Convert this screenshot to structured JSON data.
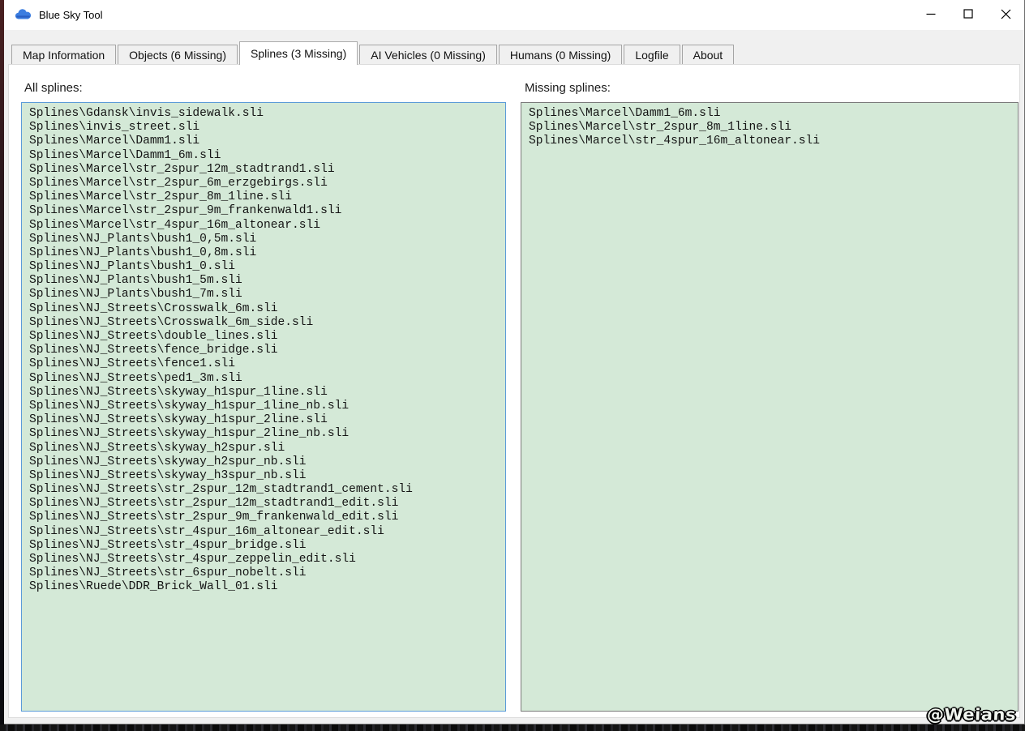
{
  "window": {
    "title": "Blue Sky Tool",
    "icon": "cloud-icon"
  },
  "tabs": [
    {
      "id": "map-information",
      "label": "Map Information",
      "active": false
    },
    {
      "id": "objects",
      "label": "Objects (6 Missing)",
      "active": false
    },
    {
      "id": "splines",
      "label": "Splines (3 Missing)",
      "active": true
    },
    {
      "id": "ai-vehicles",
      "label": "AI Vehicles (0 Missing)",
      "active": false
    },
    {
      "id": "humans",
      "label": "Humans (0 Missing)",
      "active": false
    },
    {
      "id": "logfile",
      "label": "Logfile",
      "active": false
    },
    {
      "id": "about",
      "label": "About",
      "active": false
    }
  ],
  "panels": {
    "all_splines": {
      "label": "All splines:",
      "items": [
        "Splines\\Gdansk\\invis_sidewalk.sli",
        "Splines\\invis_street.sli",
        "Splines\\Marcel\\Damm1.sli",
        "Splines\\Marcel\\Damm1_6m.sli",
        "Splines\\Marcel\\str_2spur_12m_stadtrand1.sli",
        "Splines\\Marcel\\str_2spur_6m_erzgebirgs.sli",
        "Splines\\Marcel\\str_2spur_8m_1line.sli",
        "Splines\\Marcel\\str_2spur_9m_frankenwald1.sli",
        "Splines\\Marcel\\str_4spur_16m_altonear.sli",
        "Splines\\NJ_Plants\\bush1_0,5m.sli",
        "Splines\\NJ_Plants\\bush1_0,8m.sli",
        "Splines\\NJ_Plants\\bush1_0.sli",
        "Splines\\NJ_Plants\\bush1_5m.sli",
        "Splines\\NJ_Plants\\bush1_7m.sli",
        "Splines\\NJ_Streets\\Crosswalk_6m.sli",
        "Splines\\NJ_Streets\\Crosswalk_6m_side.sli",
        "Splines\\NJ_Streets\\double_lines.sli",
        "Splines\\NJ_Streets\\fence_bridge.sli",
        "Splines\\NJ_Streets\\fence1.sli",
        "Splines\\NJ_Streets\\ped1_3m.sli",
        "Splines\\NJ_Streets\\skyway_h1spur_1line.sli",
        "Splines\\NJ_Streets\\skyway_h1spur_1line_nb.sli",
        "Splines\\NJ_Streets\\skyway_h1spur_2line.sli",
        "Splines\\NJ_Streets\\skyway_h1spur_2line_nb.sli",
        "Splines\\NJ_Streets\\skyway_h2spur.sli",
        "Splines\\NJ_Streets\\skyway_h2spur_nb.sli",
        "Splines\\NJ_Streets\\skyway_h3spur_nb.sli",
        "Splines\\NJ_Streets\\str_2spur_12m_stadtrand1_cement.sli",
        "Splines\\NJ_Streets\\str_2spur_12m_stadtrand1_edit.sli",
        "Splines\\NJ_Streets\\str_2spur_9m_frankenwald_edit.sli",
        "Splines\\NJ_Streets\\str_4spur_16m_altonear_edit.sli",
        "Splines\\NJ_Streets\\str_4spur_bridge.sli",
        "Splines\\NJ_Streets\\str_4spur_zeppelin_edit.sli",
        "Splines\\NJ_Streets\\str_6spur_nobelt.sli",
        "Splines\\Ruede\\DDR_Brick_Wall_01.sli"
      ]
    },
    "missing_splines": {
      "label": "Missing splines:",
      "items": [
        "Splines\\Marcel\\Damm1_6m.sli",
        "Splines\\Marcel\\str_2spur_8m_1line.sli",
        "Splines\\Marcel\\str_4spur_16m_altonear.sli"
      ]
    }
  },
  "watermark": "@Weians",
  "colors": {
    "listbox_background": "#d4e9d7",
    "focused_border": "#5b9bd8",
    "unfocused_border": "#7a7a7a",
    "window_background": "#f0f0f0",
    "titlebar_background": "#ffffff",
    "cloud_icon_blue": "#3b7de0"
  }
}
